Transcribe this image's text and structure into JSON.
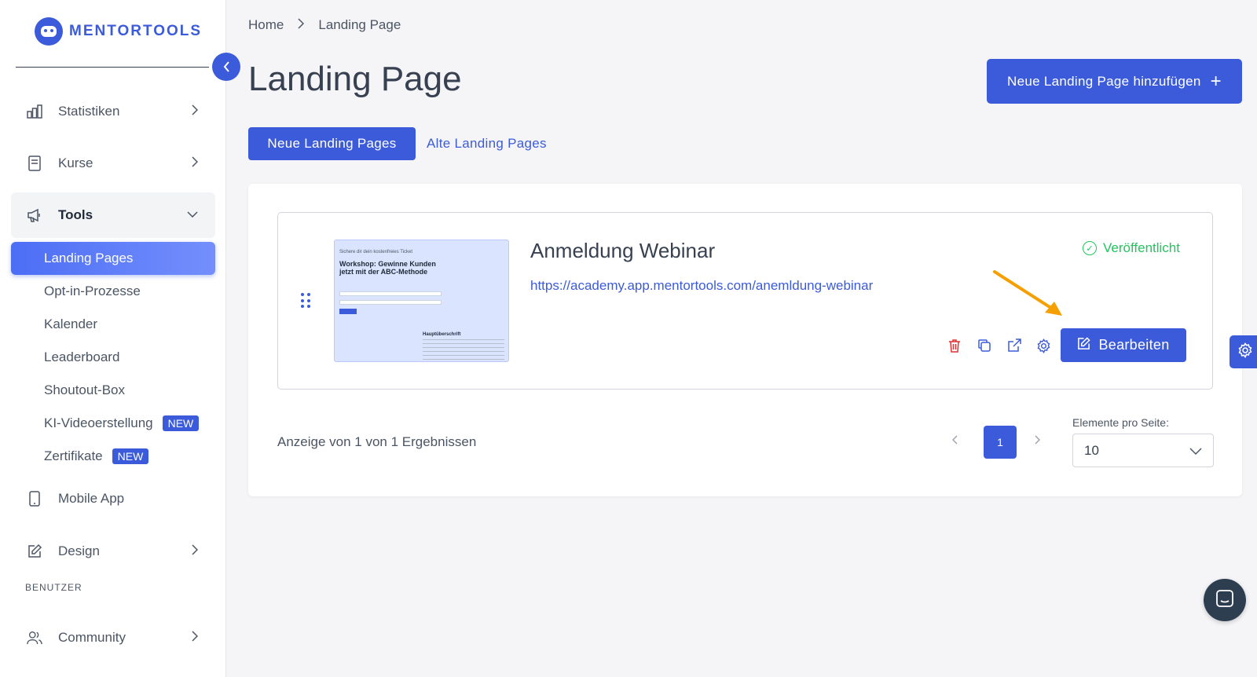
{
  "brand": {
    "name": "MENTORTOOLS",
    "accent": "#3b5bdb"
  },
  "sidebar": {
    "items": [
      {
        "label": "Statistiken",
        "icon": "bar-chart-icon"
      },
      {
        "label": "Kurse",
        "icon": "book-icon"
      },
      {
        "label": "Tools",
        "icon": "megaphone-icon"
      },
      {
        "label": "Mobile App",
        "icon": "phone-icon"
      },
      {
        "label": "Design",
        "icon": "pen-icon"
      },
      {
        "label": "Community",
        "icon": "users-icon"
      }
    ],
    "tools_sub": [
      {
        "label": "Landing Pages"
      },
      {
        "label": "Opt-in-Prozesse"
      },
      {
        "label": "Kalender"
      },
      {
        "label": "Leaderboard"
      },
      {
        "label": "Shoutout-Box"
      },
      {
        "label": "KI-Videoerstellung",
        "badge": "NEW"
      },
      {
        "label": "Zertifikate",
        "badge": "NEW"
      }
    ],
    "section_user": "BENUTZER"
  },
  "breadcrumb": {
    "home": "Home",
    "current": "Landing Page"
  },
  "page": {
    "title": "Landing Page",
    "add_button": "Neue Landing Page hinzufügen"
  },
  "tabs": {
    "active": "Neue Landing Pages",
    "inactive": "Alte Landing Pages"
  },
  "landing_page": {
    "title": "Anmeldung Webinar",
    "url": "https://academy.app.mentortools.com/anemldung-webinar",
    "status": "Veröffentlicht",
    "edit_button": "Bearbeiten",
    "thumbnail": {
      "kicker": "Sichere dir dein kostenfreies Ticket",
      "headline": "Workshop: Gewinne Kunden jetzt mit der ABC-Methode",
      "subheading": "Hauptüberschrift"
    }
  },
  "pagination": {
    "result_text": "Anzeige von 1 von 1 Ergebnissen",
    "current_page": "1",
    "per_page_label": "Elemente pro Seite:",
    "per_page_value": "10"
  }
}
